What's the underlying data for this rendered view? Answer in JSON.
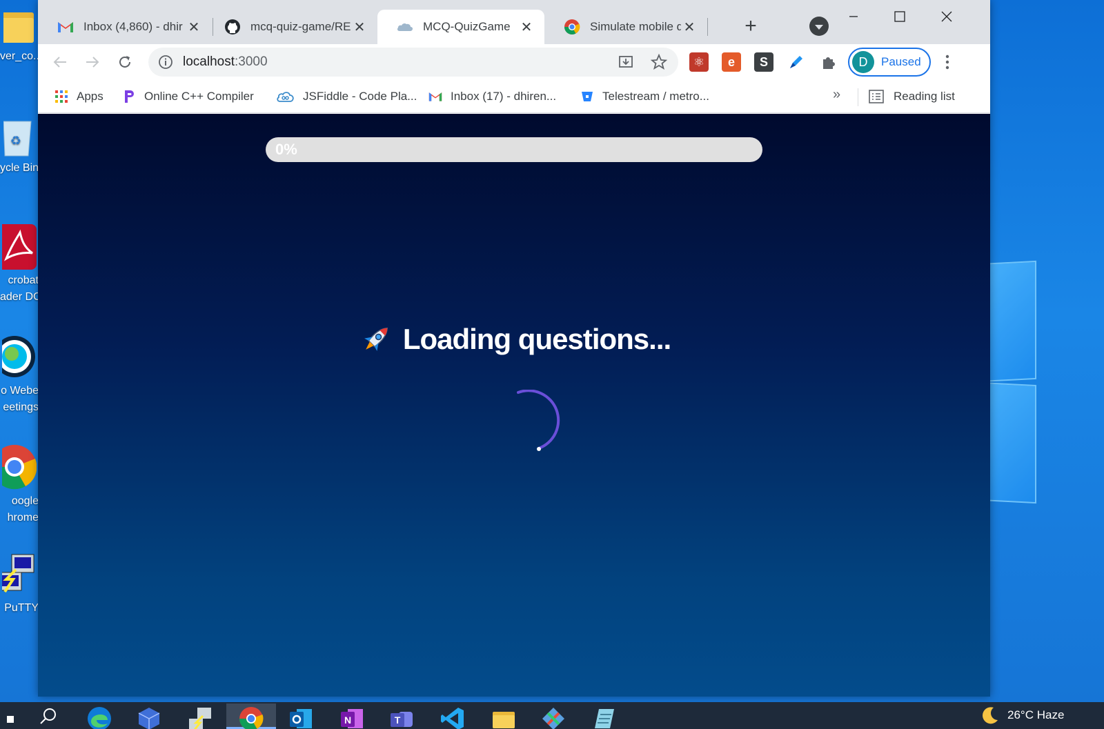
{
  "desktop": {
    "icons": [
      {
        "label": "ver_co...",
        "icon": "folder-icon"
      },
      {
        "label": "ycle Bin",
        "icon": "recycle-bin-icon"
      },
      {
        "label": "crobat",
        "label2": "ader DC",
        "icon": "acrobat-icon"
      },
      {
        "label": "o Webe",
        "label2": "eetings",
        "icon": "webex-icon"
      },
      {
        "label": "oogle",
        "label2": "hrome",
        "icon": "chrome-icon"
      },
      {
        "label": "PuTTY",
        "icon": "putty-icon"
      }
    ]
  },
  "browser": {
    "tabs": [
      {
        "title": "Inbox (4,860) - dhir",
        "icon": "gmail-icon",
        "active": false
      },
      {
        "title": "mcq-quiz-game/RE",
        "icon": "github-icon",
        "active": false
      },
      {
        "title": "MCQ-QuizGame",
        "icon": "cloud-icon",
        "active": true
      },
      {
        "title": "Simulate mobile de",
        "icon": "chrome-icon",
        "active": false
      }
    ],
    "new_tab_symbol": "+",
    "address": {
      "host": "localhost",
      "port": ":3000"
    },
    "profile": {
      "initial": "D",
      "status": "Paused",
      "color": "#12939a"
    },
    "bookmarks": [
      {
        "label": "Apps",
        "icon": "apps-grid-icon"
      },
      {
        "label": "Online C++ Compiler",
        "icon": "compiler-icon"
      },
      {
        "label": "JSFiddle - Code Pla...",
        "icon": "jsfiddle-icon"
      },
      {
        "label": "Inbox (17) - dhiren...",
        "icon": "gmail-icon"
      },
      {
        "label": "Telestream / metro...",
        "icon": "bitbucket-icon"
      }
    ],
    "bookmarks_overflow": "»",
    "reading_list": "Reading list"
  },
  "page": {
    "progress": {
      "percent": 0,
      "label": "0%"
    },
    "loading_text": "Loading questions...",
    "accent_color": "#6a4fd8"
  },
  "taskbar": {
    "weather": "26°C  Haze"
  }
}
